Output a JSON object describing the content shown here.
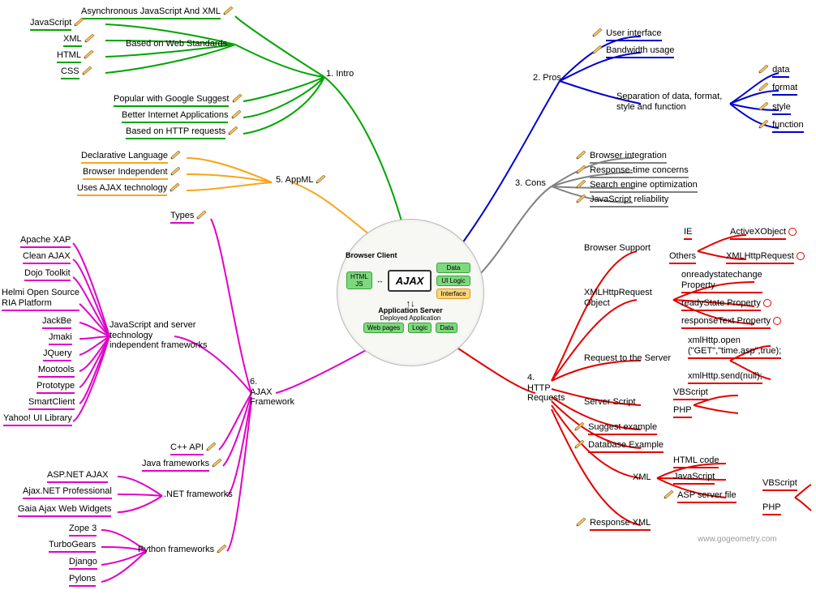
{
  "center": {
    "browser_client": "Browser Client",
    "html_js": "HTML\nJS",
    "ajax": "AJAX",
    "data": "Data",
    "ui_logic": "UI Logic",
    "interface": "Interface",
    "app_server": "Application Server",
    "deployed": "Deployed Application",
    "web_pages": "Web pages",
    "logic": "Logic",
    "data2": "Data"
  },
  "source": "www.gogeometry.com",
  "branch": {
    "intro": "1. Intro",
    "pros": "2. Pros",
    "cons": "3. Cons",
    "http": "4.\nHTTP\nRequests",
    "appml": "5. AppML",
    "ajaxfw": "6.\nAJAX\nFramework"
  },
  "intro": {
    "async": "Asynchronous JavaScript And XML",
    "stdlabel": "Based on Web Standards",
    "std": {
      "js": "JavaScript",
      "xml": "XML",
      "html": "HTML",
      "css": "CSS"
    },
    "google": "Popular with Google Suggest",
    "better": "Better Internet Applications",
    "httpreq": "Based on HTTP requests"
  },
  "pros": {
    "ui": "User interface",
    "bw": "Bandwidth usage",
    "seplabel": "Separation of data, format,\nstyle and function",
    "sep": {
      "data": "data",
      "format": "format",
      "style": "style",
      "function": "function"
    }
  },
  "cons": {
    "browser": "Browser integration",
    "rt": "Response-time concerns",
    "seo": "Search engine optimization",
    "js": "JavaScript reliability"
  },
  "appml": {
    "decl": "Declarative Language",
    "bi": "Browser Independent",
    "uses": "Uses AJAX technology"
  },
  "http": {
    "bs": {
      "label": "Browser Support",
      "ie": "IE",
      "ax": "ActiveXObject",
      "others": "Others",
      "xhr": "XMLHttpRequest"
    },
    "xo": {
      "label": "XMLHttpRequest\nObject",
      "onready": "onreadystatechange\nProperty",
      "ready": "readyState Property",
      "resp": "responseText Property"
    },
    "req": {
      "label": "Request to the Server",
      "open": "xmlHttp.open\n(\"GET\",\"time.asp\",true);",
      "send": "xmlHttp.send(null);"
    },
    "ss": {
      "label": "Server Script",
      "vb": "VBScript",
      "php": "PHP"
    },
    "sugg": "Suggest example",
    "db": "Database Example",
    "xml": {
      "label": "XML",
      "html": "HTML code",
      "js": "JavaScript",
      "asp": "ASP server file",
      "vb": "VBScript",
      "php": "PHP"
    },
    "respxml": "Response XML"
  },
  "fw": {
    "types": "Types",
    "jslabel": "JavaScript and server\ntechnology\nindependent frameworks",
    "js": {
      "xap": "Apache XAP",
      "clean": "Clean AJAX",
      "dojo": "Dojo Toolkit",
      "helmi": "Helmi Open Source\nRIA Platform",
      "jackbe": "JackBe",
      "jmaki": "Jmaki",
      "jq": "JQuery",
      "moo": "Mootools",
      "proto": "Prototype",
      "smart": "SmartClient",
      "yui": "Yahoo! UI Library"
    },
    "cpp": "C++ API",
    "java": "Java frameworks",
    "netlabel": ".NET frameworks",
    "net": {
      "asp": "ASP.NET AJAX",
      "pro": "Ajax.NET Professional",
      "gaia": "Gaia Ajax Web Widgets"
    },
    "pylabel": "Python frameworks",
    "py": {
      "zope": "Zope 3",
      "turbo": "TurboGears",
      "dj": "Django",
      "pylons": "Pylons"
    }
  }
}
